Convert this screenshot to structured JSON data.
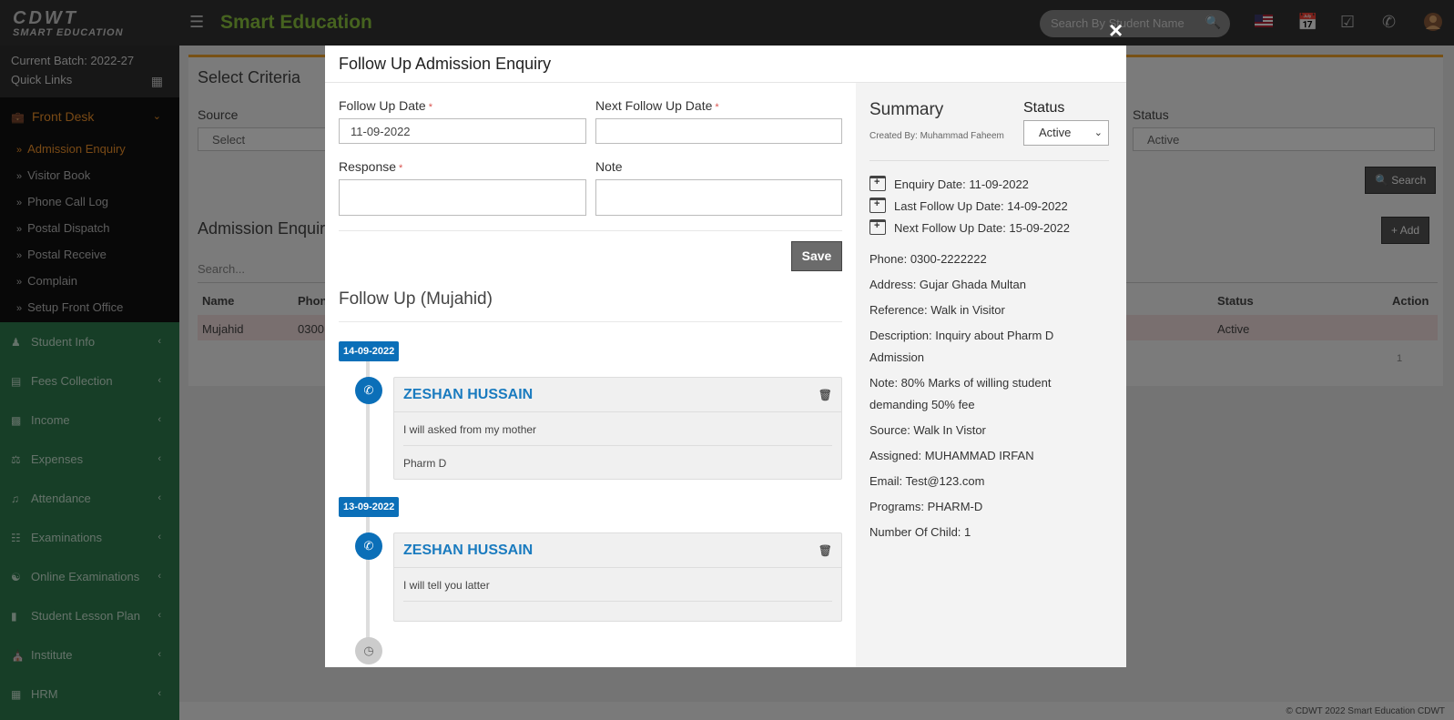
{
  "topbar": {
    "logo_line1": "CDWT",
    "logo_line2": "SMART EDUCATION",
    "brand": "Smart Education",
    "search_placeholder": "Search By Student Name"
  },
  "sidebar": {
    "batch": "Current Batch: 2022-27",
    "quick_links": "Quick Links",
    "front_desk": "Front Desk",
    "front_desk_items": [
      "Admission Enquiry",
      "Visitor Book",
      "Phone Call Log",
      "Postal Dispatch",
      "Postal Receive",
      "Complain",
      "Setup Front Office"
    ],
    "menu": [
      "Student Info",
      "Fees Collection",
      "Income",
      "Expenses",
      "Attendance",
      "Examinations",
      "Online Examinations",
      "Student Lesson Plan",
      "Institute",
      "HRM"
    ]
  },
  "background": {
    "select_criteria": "Select Criteria",
    "source_label": "Source",
    "source_value": "Select",
    "status_label": "Status",
    "status_value": "Active",
    "search_btn": "Search",
    "list_title": "Admission Enquiry",
    "add_btn": "Add",
    "search_placeholder": "Search...",
    "col_name": "Name",
    "col_phone": "Phone",
    "col_status": "Status",
    "col_action": "Action",
    "row_name": "Mujahid",
    "row_phone": "0300",
    "row_status": "Active",
    "page": "1",
    "footer": "© CDWT 2022 Smart Education CDWT"
  },
  "modal": {
    "title": "Follow Up Admission Enquiry",
    "close": "×",
    "follow_up_date_label": "Follow Up Date",
    "follow_up_date_value": "11-09-2022",
    "next_follow_up_label": "Next Follow Up Date",
    "next_follow_up_value": "",
    "response_label": "Response",
    "response_value": "",
    "note_label": "Note",
    "note_value": "",
    "save": "Save",
    "followup_title": "Follow Up (Mujahid)",
    "timeline": [
      {
        "date": "14-09-2022",
        "name": "ZESHAN HUSSAIN",
        "lines": [
          "I will asked from my mother",
          "Pharm D"
        ]
      },
      {
        "date": "13-09-2022",
        "name": "ZESHAN HUSSAIN",
        "lines": [
          "I will tell you latter",
          ""
        ]
      }
    ]
  },
  "summary": {
    "title": "Summary",
    "created_by": "Created By: Muhammad Faheem",
    "status_label": "Status",
    "status_value": "Active",
    "enquiry_date": "Enquiry Date: 11-09-2022",
    "last_follow_up": "Last Follow Up Date: 14-09-2022",
    "next_follow_up": "Next Follow Up Date: 15-09-2022",
    "phone": "Phone: 0300-2222222",
    "address": "Address: Gujar Ghada Multan",
    "reference": "Reference: Walk in Visitor",
    "description": "Description: Inquiry about Pharm D Admission",
    "note": "Note: 80% Marks of willing student demanding 50% fee",
    "source": "Source: Walk In Vistor",
    "assigned": "Assigned: MUHAMMAD IRFAN",
    "email": "Email: Test@123.com",
    "programs": "Programs: PHARM-D",
    "children": "Number Of Child: 1"
  }
}
